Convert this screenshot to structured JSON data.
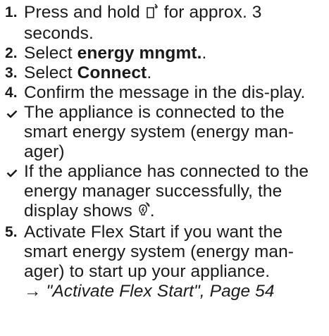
{
  "steps": [
    {
      "marker": "1.",
      "pre": "Press and hold ",
      "icon": "remote-start-icon",
      "post": " for approx. 3 seconds."
    },
    {
      "marker": "2.",
      "pre": "Select ",
      "bold": "energy mngmt.",
      "post": "."
    },
    {
      "marker": "3.",
      "pre": "Select ",
      "bold": "Connect",
      "post": "."
    },
    {
      "marker": "4.",
      "text": "Confirm the message in the dis-play."
    }
  ],
  "results": [
    {
      "text": "The appliance is connected to the smart energy system (energy man-ager)"
    },
    {
      "pre": "If the appliance has connected to the energy manager successfully, the display shows ",
      "icon": "energy-manager-connected-icon",
      "post": "."
    }
  ],
  "step5": {
    "marker": "5.",
    "text": "Activate Flex Start if you want the smart energy system (energy man-ager) to start up your appliance.",
    "xref_arrow": "→",
    "xref": "\"Activate Flex Start\", Page 54"
  }
}
